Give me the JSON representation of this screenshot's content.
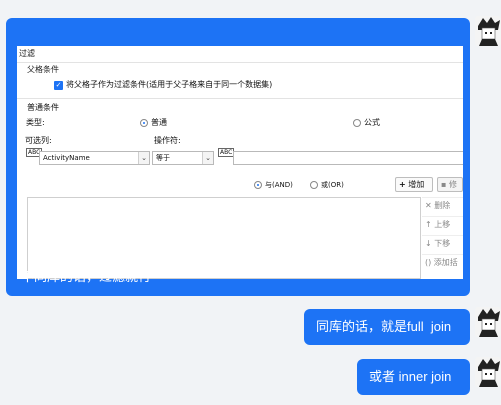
{
  "screenshot": {
    "title": "过滤",
    "parent_section": "父格条件",
    "parent_checkbox_label": "将父格子作为过滤条件(适用于父子格来自于同一个数据集)",
    "normal_section": "普通条件",
    "type_label": "类型:",
    "type_normal": "普通",
    "type_formula": "公式",
    "candidate_label": "可选列:",
    "operator_label": "操作符:",
    "column_value": "ActivityName",
    "operator_value": "等于",
    "and_label": "与(AND)",
    "or_label": "或(OR)",
    "add_button": "增加",
    "delete_button": "删除",
    "up_button": "上移",
    "down_button": "下移",
    "add_bracket_button": "添加括",
    "modify_button": "修",
    "abc_icon_text": "ABC"
  },
  "messages": [
    {
      "text": "不同库的话，过滤就行"
    },
    {
      "text": "同库的话，就是full  join"
    },
    {
      "text": "或者 inner join"
    }
  ],
  "colors": {
    "bubble": "#1d73f5",
    "page_bg": "#f1f3f6"
  }
}
